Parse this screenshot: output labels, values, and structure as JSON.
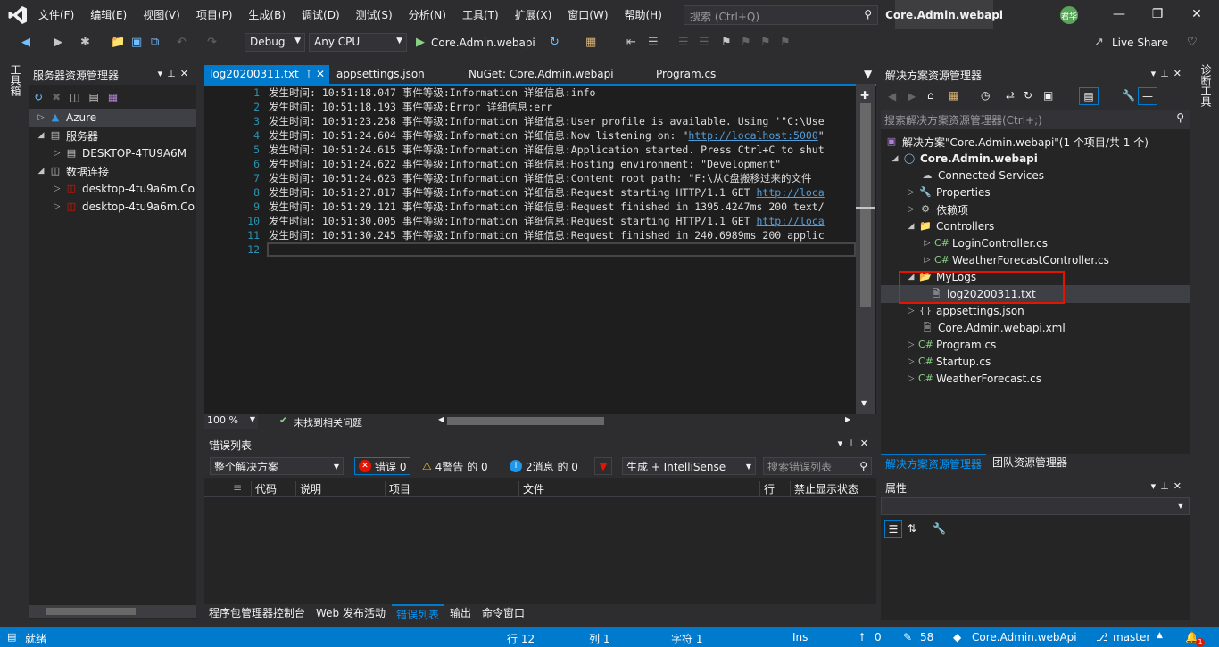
{
  "menu": {
    "items": [
      "文件(F)",
      "编辑(E)",
      "视图(V)",
      "项目(P)",
      "生成(B)",
      "调试(D)",
      "测试(S)",
      "分析(N)",
      "工具(T)",
      "扩展(X)",
      "窗口(W)",
      "帮助(H)"
    ]
  },
  "title": {
    "search_placeholder": "搜索 (Ctrl+Q)",
    "window_title": "Core.Admin.webapi",
    "avatar": "君华"
  },
  "toolbar": {
    "config": "Debug",
    "platform": "Any CPU",
    "run_target": "Core.Admin.webapi",
    "live_share": "Live Share"
  },
  "strips": {
    "left": "工具箱",
    "right": "诊断工具"
  },
  "server_explorer": {
    "title": "服务器资源管理器",
    "nodes": [
      {
        "label": "Azure"
      },
      {
        "label": "服务器"
      },
      {
        "label": "DESKTOP-4TU9A6M"
      },
      {
        "label": "数据连接"
      },
      {
        "label": "desktop-4tu9a6m.Co"
      },
      {
        "label": "desktop-4tu9a6m.Co"
      }
    ]
  },
  "editor": {
    "tabs": [
      "log20200311.txt",
      "appsettings.json",
      "NuGet: Core.Admin.webapi",
      "Program.cs"
    ],
    "line_numbers": [
      "1",
      "2",
      "3",
      "4",
      "5",
      "6",
      "7",
      "8",
      "9",
      "10",
      "11",
      "12"
    ],
    "lines": [
      {
        "pre": "发生时间: 10:51:18.047 事件等级:Information 详细信息:info",
        "link": "",
        "post": ""
      },
      {
        "pre": "发生时间: 10:51:18.193 事件等级:Error 详细信息:err",
        "link": "",
        "post": ""
      },
      {
        "pre": "发生时间: 10:51:23.258 事件等级:Information 详细信息:User profile is available. Using '\"C:\\Use",
        "link": "",
        "post": ""
      },
      {
        "pre": "发生时间: 10:51:24.604 事件等级:Information 详细信息:Now listening on: \"",
        "link": "http://localhost:5000",
        "post": "\""
      },
      {
        "pre": "发生时间: 10:51:24.615 事件等级:Information 详细信息:Application started. Press Ctrl+C to shut",
        "link": "",
        "post": ""
      },
      {
        "pre": "发生时间: 10:51:24.622 事件等级:Information 详细信息:Hosting environment: \"Development\"",
        "link": "",
        "post": ""
      },
      {
        "pre": "发生时间: 10:51:24.623 事件等级:Information 详细信息:Content root path: \"F:\\从C盘搬移过来的文件",
        "link": "",
        "post": ""
      },
      {
        "pre": "发生时间: 10:51:27.817 事件等级:Information 详细信息:Request starting HTTP/1.1 GET ",
        "link": "http://loca",
        "post": ""
      },
      {
        "pre": "发生时间: 10:51:29.121 事件等级:Information 详细信息:Request finished in 1395.4247ms 200 text/",
        "link": "",
        "post": ""
      },
      {
        "pre": "发生时间: 10:51:30.005 事件等级:Information 详细信息:Request starting HTTP/1.1 GET ",
        "link": "http://loca",
        "post": ""
      },
      {
        "pre": "发生时间: 10:51:30.245 事件等级:Information 详细信息:Request finished in 240.6989ms 200 applic",
        "link": "",
        "post": ""
      },
      {
        "pre": "",
        "link": "",
        "post": ""
      }
    ],
    "zoom": "100 %",
    "issues": "未找到相关问题"
  },
  "error_list": {
    "title": "错误列表",
    "scope": "整个解决方案",
    "errors": "错误 0",
    "warnings": "4警告 的 0",
    "messages": "2消息 的 0",
    "build_filter": "生成 + IntelliSense",
    "search_placeholder": "搜索错误列表",
    "columns": [
      "代码",
      "说明",
      "项目",
      "文件",
      "行",
      "禁止显示状态"
    ]
  },
  "bottom_tabs": [
    "程序包管理器控制台",
    "Web 发布活动",
    "错误列表",
    "输出",
    "命令窗口"
  ],
  "solution_explorer": {
    "title": "解决方案资源管理器",
    "search_placeholder": "搜索解决方案资源管理器(Ctrl+;)",
    "items": [
      {
        "label": "解决方案\"Core.Admin.webapi\"(1 个项目/共 1 个)"
      },
      {
        "label": "Core.Admin.webapi"
      },
      {
        "label": "Connected Services"
      },
      {
        "label": "Properties"
      },
      {
        "label": "依赖项"
      },
      {
        "label": "Controllers"
      },
      {
        "label": "LoginController.cs"
      },
      {
        "label": "WeatherForecastController.cs"
      },
      {
        "label": "MyLogs"
      },
      {
        "label": "log20200311.txt"
      },
      {
        "label": "appsettings.json"
      },
      {
        "label": "Core.Admin.webapi.xml"
      },
      {
        "label": "Program.cs"
      },
      {
        "label": "Startup.cs"
      },
      {
        "label": "WeatherForecast.cs"
      }
    ],
    "tabs": [
      "解决方案资源管理器",
      "团队资源管理器"
    ]
  },
  "properties": {
    "title": "属性"
  },
  "statusbar": {
    "ready": "就绪",
    "line": "行 12",
    "col": "列 1",
    "char": "字符 1",
    "ins": "Ins",
    "up": "0",
    "pencil": "58",
    "repo": "Core.Admin.webApi",
    "branch": "master",
    "notif": "1"
  },
  "colors": {
    "accent": "#007acc",
    "highlight": "#e51400",
    "link": "#569cd6"
  }
}
